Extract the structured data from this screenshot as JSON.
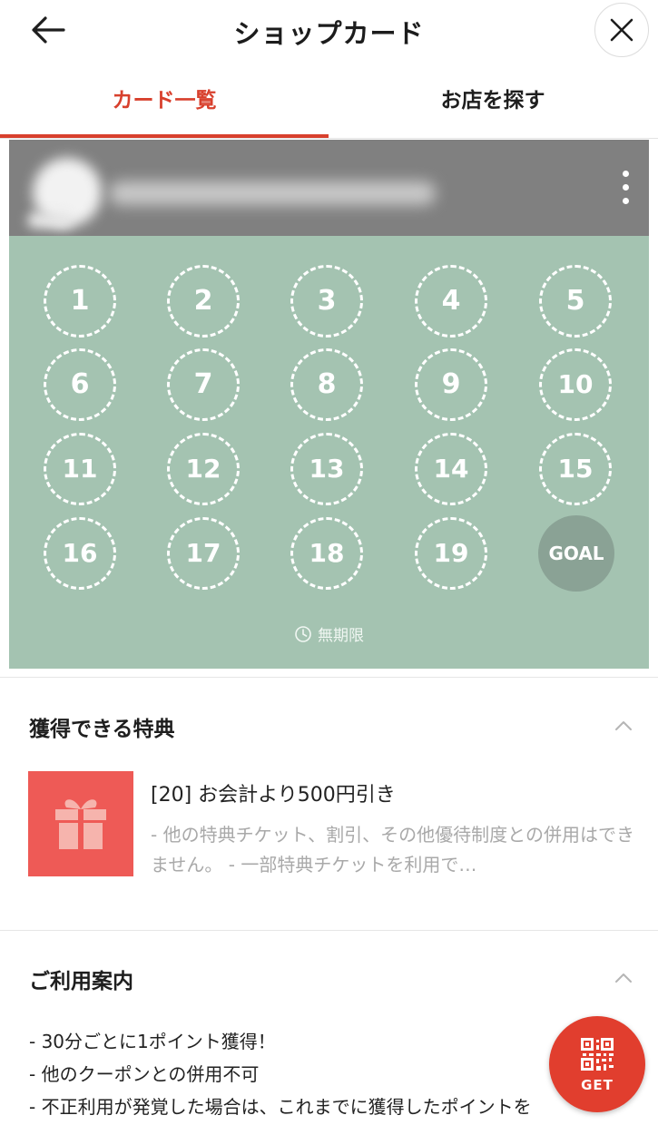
{
  "header": {
    "title": "ショップカード"
  },
  "tabs": [
    {
      "label": "カード一覧",
      "active": true
    },
    {
      "label": "お店を探す",
      "active": false
    }
  ],
  "card": {
    "stamps": [
      "1",
      "2",
      "3",
      "4",
      "5",
      "6",
      "7",
      "8",
      "9",
      "10",
      "11",
      "12",
      "13",
      "14",
      "15",
      "16",
      "17",
      "18",
      "19"
    ],
    "goal_label": "GOAL",
    "expiry": "無期限",
    "colors": {
      "body": "#a4c3b1",
      "header": "#808080",
      "goal": "#8aa295"
    }
  },
  "benefits": {
    "title": "獲得できる特典",
    "item": {
      "title": "[20] お会計より500円引き",
      "desc": "- 他の特典チケット、割引、その他優待制度との併用はできません。 - 一部特典チケットを利用で…"
    }
  },
  "usage": {
    "title": "ご利用案内",
    "lines": [
      "- 30分ごとに1ポイント獲得！",
      "- 他のクーポンとの併用不可",
      "- 不正利用が発覚した場合は、これまでに獲得したポイントを"
    ]
  },
  "fab": {
    "label": "GET"
  },
  "accent_color": "#d8402d"
}
